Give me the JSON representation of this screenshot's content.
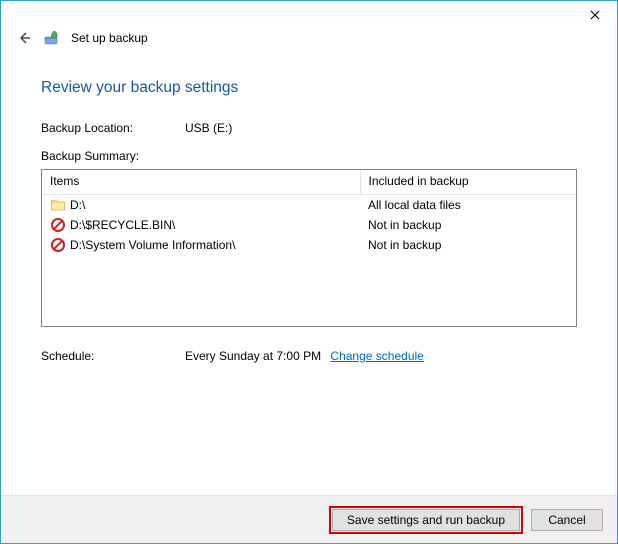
{
  "window": {
    "wizard_title": "Set up backup"
  },
  "page": {
    "heading": "Review your backup settings",
    "location_label": "Backup Location:",
    "location_value": "USB (E:)",
    "summary_label": "Backup Summary:"
  },
  "summary": {
    "col_items": "Items",
    "col_included": "Included in backup",
    "rows": [
      {
        "icon": "folder",
        "path": "D:\\",
        "included": "All local data files"
      },
      {
        "icon": "excluded",
        "path": "D:\\$RECYCLE.BIN\\",
        "included": "Not in backup"
      },
      {
        "icon": "excluded",
        "path": "D:\\System Volume Information\\",
        "included": "Not in backup"
      }
    ]
  },
  "schedule": {
    "label": "Schedule:",
    "value": "Every Sunday at 7:00 PM",
    "change_link": "Change schedule"
  },
  "buttons": {
    "primary": "Save settings and run backup",
    "cancel": "Cancel"
  }
}
